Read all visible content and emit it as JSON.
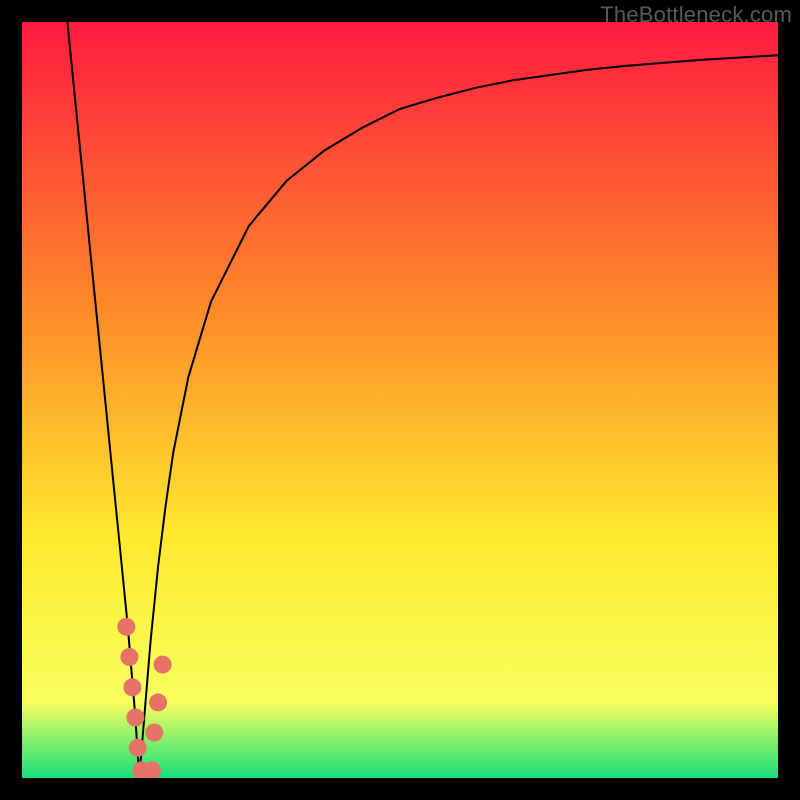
{
  "watermark": "TheBottleneck.com",
  "colors": {
    "black": "#000000",
    "curve": "#000000",
    "marker": "#e57368",
    "grad_top": "#ff1a40",
    "grad_mid1": "#ff8a2a",
    "grad_mid2": "#ffe92e",
    "grad_mid3": "#f8ff5e",
    "grad_bottom": "#14e07a"
  },
  "chart_data": {
    "type": "line",
    "title": "",
    "xlabel": "",
    "ylabel": "",
    "xlim": [
      0,
      100
    ],
    "ylim": [
      0,
      100
    ],
    "valley_x": 15.5,
    "series": [
      {
        "name": "bottleneck-curve",
        "x": [
          6,
          7,
          8,
          9,
          10,
          11,
          12,
          13,
          14,
          15,
          15.5,
          16,
          17,
          18,
          19,
          20,
          22,
          25,
          30,
          35,
          40,
          45,
          50,
          55,
          60,
          65,
          70,
          75,
          80,
          85,
          90,
          95,
          100
        ],
        "y": [
          100,
          90,
          80,
          70,
          60,
          50,
          40,
          30,
          20,
          8,
          0,
          6,
          18,
          28,
          36,
          43,
          53,
          63,
          73,
          79,
          83,
          86,
          88.5,
          90,
          91.3,
          92.3,
          93,
          93.7,
          94.2,
          94.6,
          95,
          95.3,
          95.6
        ]
      }
    ],
    "markers": [
      {
        "name": "marker-left-1",
        "x": 13.8,
        "y": 20
      },
      {
        "name": "marker-left-2",
        "x": 14.2,
        "y": 16
      },
      {
        "name": "marker-left-3",
        "x": 14.6,
        "y": 12
      },
      {
        "name": "marker-left-4",
        "x": 15.0,
        "y": 8
      },
      {
        "name": "marker-left-5",
        "x": 15.3,
        "y": 4
      },
      {
        "name": "marker-valley",
        "x": 15.8,
        "y": 1
      },
      {
        "name": "marker-right-1",
        "x": 17.2,
        "y": 1
      },
      {
        "name": "marker-right-2",
        "x": 17.5,
        "y": 6
      },
      {
        "name": "marker-right-3",
        "x": 18.0,
        "y": 10
      },
      {
        "name": "marker-right-4",
        "x": 18.6,
        "y": 15
      }
    ]
  }
}
